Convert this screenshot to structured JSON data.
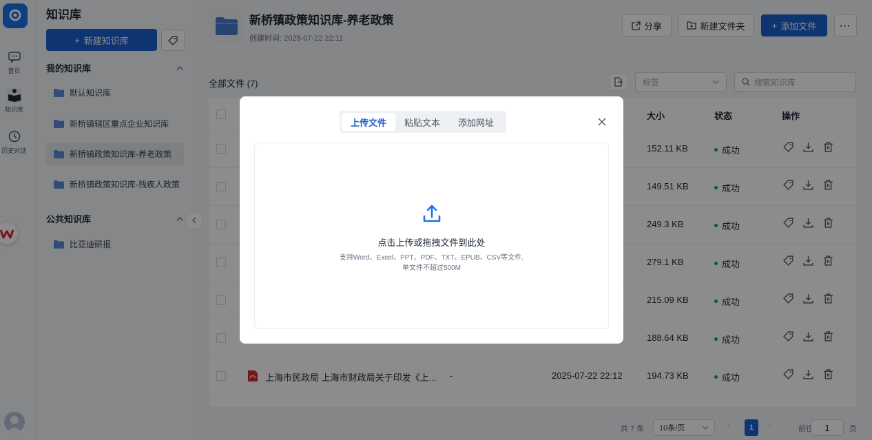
{
  "rail": {
    "items": [
      {
        "label": "首页",
        "icon": "chat-icon"
      },
      {
        "label": "知识库",
        "icon": "book-reader-icon"
      },
      {
        "label": "历史对话",
        "icon": "clock-icon"
      }
    ]
  },
  "sidebar": {
    "title": "知识库",
    "new_kb_label": "新建知识库",
    "my_section": "我的知识库",
    "my_items": [
      "默认知识库",
      "新桥镇辖区重点企业知识库",
      "新桥镇政策知识库-养老政策",
      "新桥镇政策知识库-残疾人政策"
    ],
    "public_section": "公共知识库",
    "public_items": [
      "比亚迪研报"
    ]
  },
  "header": {
    "title": "新桥镇政策知识库-养老政策",
    "created": "创建时间: 2025-07-22 22:11",
    "share": "分享",
    "new_folder": "新建文件夹",
    "add_file": "添加文件"
  },
  "toolbar": {
    "all_files": "全部文件 (7)",
    "tag_placeholder": "标签",
    "search_placeholder": "搜索知识库"
  },
  "table": {
    "columns": {
      "size": "大小",
      "status": "状态",
      "actions": "操作"
    },
    "rows": [
      {
        "size": "152.11 KB",
        "status": "成功"
      },
      {
        "size": "149.51 KB",
        "status": "成功"
      },
      {
        "size": "249.3 KB",
        "status": "成功"
      },
      {
        "size": "279.1 KB",
        "status": "成功"
      },
      {
        "size": "215.09 KB",
        "status": "成功"
      },
      {
        "size": "188.64 KB",
        "status": "成功"
      },
      {
        "name": "上海市民政局 上海市财政局关于印发《上...",
        "tag": "-",
        "date": "2025-07-22 22:12",
        "size": "194.73 KB",
        "status": "成功"
      }
    ]
  },
  "pager": {
    "total": "共 7 条",
    "page_size": "10条/页",
    "current": "1",
    "goto_label": "前往",
    "goto_value": "1",
    "page_suffix": "页"
  },
  "modal": {
    "tabs": [
      "上传文件",
      "粘贴文本",
      "添加网址"
    ],
    "drop_title": "点击上传或拖拽文件到此处",
    "drop_formats": "支持Word、Excel、PPT、PDF、TXT、EPUB、CSV等文件,",
    "drop_limit": "单文件不超过500M"
  },
  "colors": {
    "accent": "#1a5fd0",
    "success": "#16a34a"
  }
}
